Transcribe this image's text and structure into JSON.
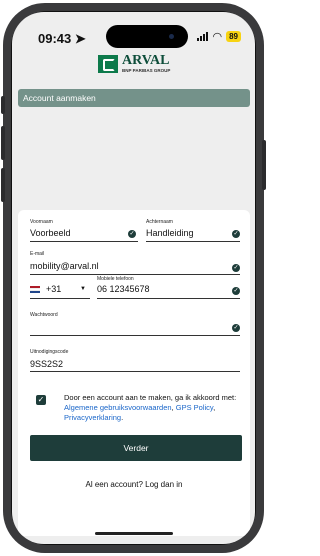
{
  "status": {
    "time": "09:43",
    "battery": "89"
  },
  "logo": {
    "name": "ARVAL",
    "subtitle": "BNP PARIBAS GROUP"
  },
  "header": {
    "title": "Account aanmaken"
  },
  "form": {
    "first_name": {
      "label": "Voornaam",
      "value": "Voorbeeld"
    },
    "last_name": {
      "label": "Achternaam",
      "value": "Handleiding"
    },
    "email": {
      "label": "E-mail",
      "value": "mobility@arval.nl"
    },
    "phone": {
      "country_code": "+31",
      "label": "Mobiele telefoon",
      "value": "06 12345678"
    },
    "password": {
      "label": "Wachtwoord",
      "value": ""
    },
    "invite_code": {
      "label": "Uitnodigingscode",
      "value": "9SS2S2"
    },
    "consent": {
      "prefix": "Door een account aan te maken, ga ik akkoord met: ",
      "terms_link": "Algemene gebruiksvoorwaarden",
      "sep1": ", ",
      "gps_link": "GPS Policy",
      "sep2": ", ",
      "privacy_link": "Privacyverklaring",
      "suffix": "."
    },
    "submit_label": "Verder",
    "login_prompt": "Al een account? Log dan in"
  },
  "colors": {
    "brand": "#1e3d3a",
    "header_bg": "#74928a",
    "link": "#1a66c9",
    "battery": "#f7d312"
  }
}
